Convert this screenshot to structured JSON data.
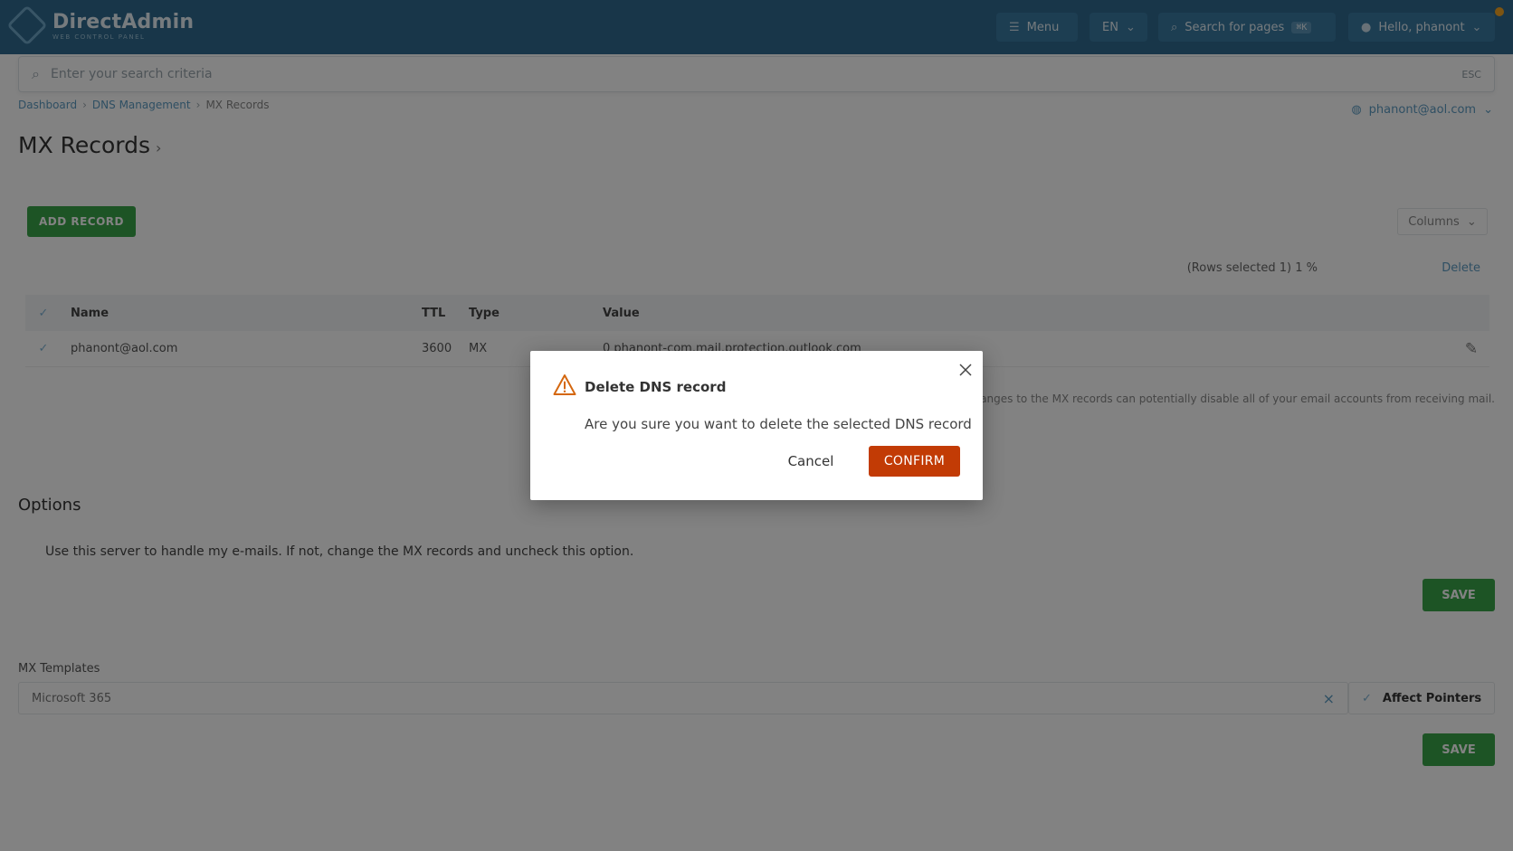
{
  "app": {
    "logo_title": "DirectAdmin",
    "logo_sub": "WEB CONTROL PANEL"
  },
  "topbar": {
    "menu_label": "Menu",
    "lang_label": "EN",
    "search_pages_label": "Search for pages",
    "search_shortcut": "⌘K",
    "user_label": "Hello, phanont"
  },
  "search": {
    "placeholder": "Enter your search criteria",
    "esc_hint": "ESC"
  },
  "breadcrumb": {
    "items": [
      "Dashboard",
      "DNS Management",
      "MX Records"
    ]
  },
  "domain_selector": "phanont@aol.com",
  "page": {
    "title": "MX Records"
  },
  "toolbar": {
    "add_record_label": "ADD RECORD",
    "columns_label": "Columns",
    "selected_info": "(Rows selected 1) 1 %",
    "delete_label": "Delete"
  },
  "table": {
    "headers": [
      "Name",
      "TTL",
      "Type",
      "Value"
    ],
    "rows": [
      {
        "name": "phanont@aol.com",
        "ttl": "3600",
        "type": "MX",
        "value": "0 phanont-com.mail.protection.outlook.com"
      }
    ]
  },
  "warning_text": "Changes to the MX records can potentially disable all of your email accounts from receiving mail.",
  "options": {
    "title": "Options",
    "checkbox_label": "Use this server to handle my e-mails. If not, change the MX records and uncheck this option.",
    "save_label": "SAVE"
  },
  "mx_templates": {
    "label": "MX Templates",
    "selected": "Microsoft 365",
    "affect_label": "Affect Pointers",
    "save_label": "SAVE"
  },
  "modal": {
    "title": "Delete DNS record",
    "body": "Are you sure you want to delete the selected DNS record",
    "cancel_label": "Cancel",
    "confirm_label": "CONFIRM"
  },
  "colors": {
    "topbar": "#2f6a8f",
    "accent": "#5d9cc3",
    "success": "#3aa64a",
    "danger": "#c23b05",
    "warning_icon": "#d4670f"
  }
}
